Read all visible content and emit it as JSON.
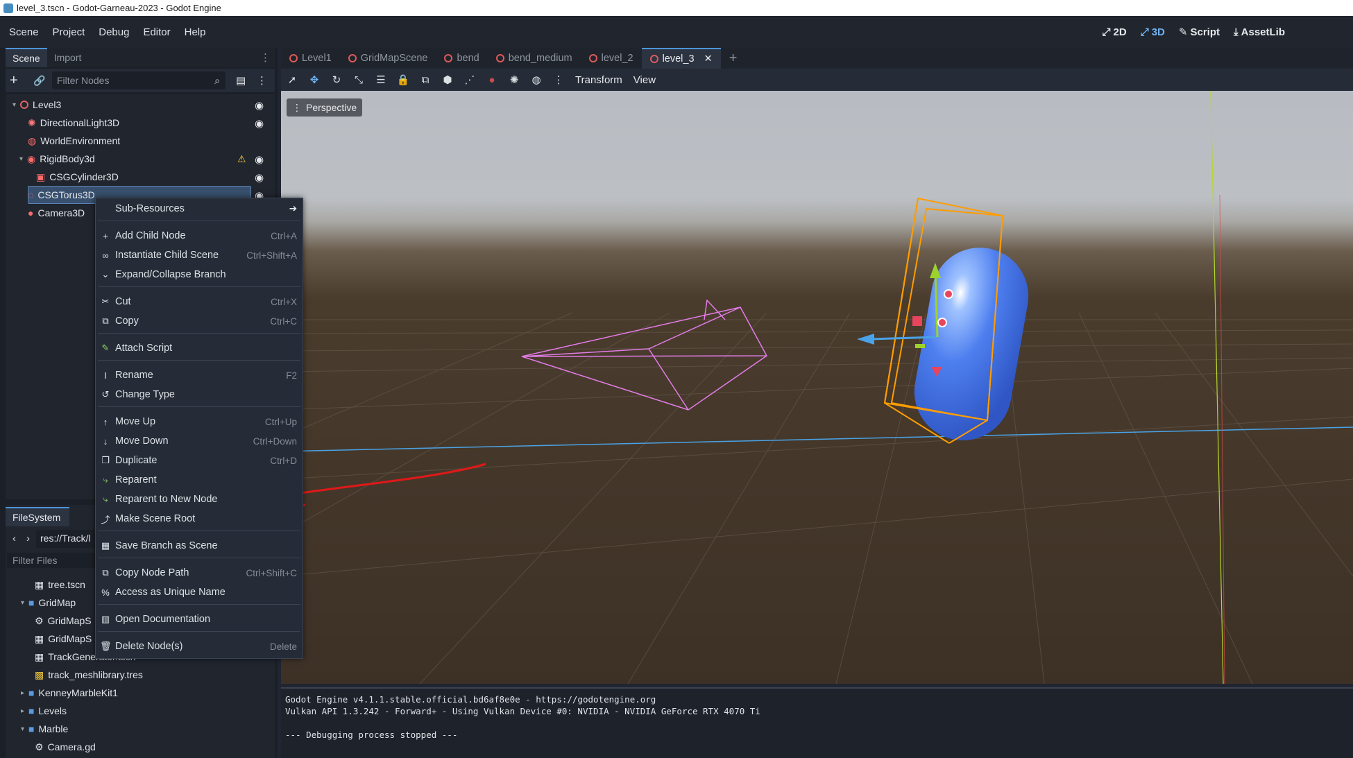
{
  "window": {
    "title": "level_3.tscn - Godot-Garneau-2023 - Godot Engine"
  },
  "menubar": {
    "items": [
      "Scene",
      "Project",
      "Debug",
      "Editor",
      "Help"
    ]
  },
  "workspaces": {
    "items": [
      "2D",
      "3D",
      "Script",
      "AssetLib"
    ],
    "active": "3D"
  },
  "scene_dock": {
    "tabs": [
      "Scene",
      "Import"
    ],
    "filter_placeholder": "Filter Nodes",
    "nodes": [
      {
        "label": "Level3",
        "icon": "node3d-icon"
      },
      {
        "label": "DirectionalLight3D",
        "icon": "light-icon"
      },
      {
        "label": "WorldEnvironment",
        "icon": "world-icon"
      },
      {
        "label": "RigidBody3d",
        "icon": "rigidbody-icon"
      },
      {
        "label": "CSGCylinder3D",
        "icon": "csg-icon"
      },
      {
        "label": "CSGTorus3D",
        "icon": "csg-torus-icon"
      },
      {
        "label": "Camera3D",
        "icon": "camera-icon"
      }
    ],
    "selected": "CSGTorus3D"
  },
  "filesystem_dock": {
    "tab": "FileSystem",
    "path": "res://Track/l",
    "filter_placeholder": "Filter Files",
    "items": [
      {
        "label": "tree.tscn"
      },
      {
        "label": "GridMap"
      },
      {
        "label": "GridMapS"
      },
      {
        "label": "GridMapS"
      },
      {
        "label": "TrackGenerator.tscn"
      },
      {
        "label": "track_meshlibrary.tres"
      },
      {
        "label": "KenneyMarbleKit1"
      },
      {
        "label": "Levels"
      },
      {
        "label": "Marble"
      },
      {
        "label": "Camera.gd"
      }
    ]
  },
  "context_menu": {
    "items": [
      {
        "label": "Sub-Resources",
        "shortcut": "",
        "icon": "submenu-arrow-icon"
      },
      {
        "label": "Add Child Node",
        "shortcut": "Ctrl+A",
        "icon": "add-icon"
      },
      {
        "label": "Instantiate Child Scene",
        "shortcut": "Ctrl+Shift+A",
        "icon": "link-icon"
      },
      {
        "label": "Expand/Collapse Branch",
        "shortcut": "",
        "icon": "chevron-down-icon"
      },
      {
        "label": "Cut",
        "shortcut": "Ctrl+X",
        "icon": "scissors-icon"
      },
      {
        "label": "Copy",
        "shortcut": "Ctrl+C",
        "icon": "copy-icon"
      },
      {
        "label": "Attach Script",
        "shortcut": "",
        "icon": "script-icon"
      },
      {
        "label": "Rename",
        "shortcut": "F2",
        "icon": "text-cursor-icon"
      },
      {
        "label": "Change Type",
        "shortcut": "",
        "icon": "rotate-icon"
      },
      {
        "label": "Move Up",
        "shortcut": "Ctrl+Up",
        "icon": "arrow-up-icon"
      },
      {
        "label": "Move Down",
        "shortcut": "Ctrl+Down",
        "icon": "arrow-down-icon"
      },
      {
        "label": "Duplicate",
        "shortcut": "Ctrl+D",
        "icon": "duplicate-icon"
      },
      {
        "label": "Reparent",
        "shortcut": "",
        "icon": "reparent-icon"
      },
      {
        "label": "Reparent to New Node",
        "shortcut": "",
        "icon": "reparent-new-icon"
      },
      {
        "label": "Make Scene Root",
        "shortcut": "",
        "icon": "scene-root-icon"
      },
      {
        "label": "Save Branch as Scene",
        "shortcut": "",
        "icon": "save-scene-icon"
      },
      {
        "label": "Copy Node Path",
        "shortcut": "Ctrl+Shift+C",
        "icon": "copy-path-icon"
      },
      {
        "label": "Access as Unique Name",
        "shortcut": "",
        "icon": "percent-icon"
      },
      {
        "label": "Open Documentation",
        "shortcut": "",
        "icon": "docs-icon"
      },
      {
        "label": "Delete Node(s)",
        "shortcut": "Delete",
        "icon": "trash-icon"
      }
    ]
  },
  "editor_tabs": {
    "items": [
      "Level1",
      "GridMapScene",
      "bend",
      "bend_medium",
      "level_2",
      "level_3"
    ],
    "active": "level_3",
    "close_glyph": "✕",
    "add_glyph": "+"
  },
  "viewport_toolbar": {
    "transform_label": "Transform",
    "view_label": "View"
  },
  "viewport": {
    "perspective_label": "Perspective"
  },
  "console": {
    "lines": [
      "Godot Engine v4.1.1.stable.official.bd6af8e0e - https://godotengine.org",
      "Vulkan API 1.3.242 - Forward+ - Using Vulkan Device #0: NVIDIA - NVIDIA GeForce RTX 4070 Ti",
      "",
      "--- Debugging process stopped ---"
    ]
  },
  "colors": {
    "accent": "#4e94d9",
    "annotation_arrow": "#e01818",
    "selection_box": "#ff9d00",
    "capsule": "#3f73e8"
  }
}
